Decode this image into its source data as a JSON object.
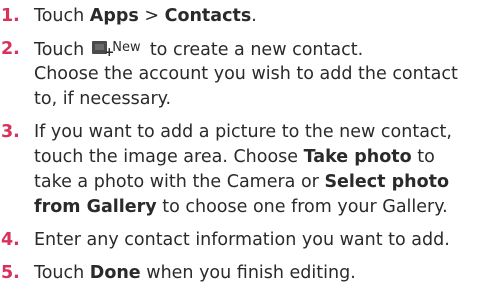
{
  "steps": [
    {
      "number": "1.",
      "lines": [
        {
          "a": "Touch ",
          "b1": "Apps",
          "c": " > ",
          "b2": "Contacts",
          "d": "."
        }
      ]
    },
    {
      "number": "2.",
      "icon_name": "new-contact-icon",
      "icon_label": "New",
      "lines": [
        {
          "a": "Touch",
          "after_icon": "to create a new contact."
        },
        {
          "a": "Choose the account you wish to add the contact"
        },
        {
          "a": "to, if necessary."
        }
      ]
    },
    {
      "number": "3.",
      "lines": [
        {
          "a": "If you want to add a picture to the new contact,"
        },
        {
          "a": "touch the image area. Choose ",
          "b1": "Take photo",
          "c": " to"
        },
        {
          "a": "take a photo with the Camera or ",
          "b1": "Select photo"
        },
        {
          "b1": "from Gallery",
          "c": " to choose one from your Gallery."
        }
      ]
    },
    {
      "number": "4.",
      "lines": [
        {
          "a": "Enter any contact information you want to add."
        }
      ]
    },
    {
      "number": "5.",
      "lines": [
        {
          "a": "Touch ",
          "b1": "Done",
          "c": " when you finish editing."
        }
      ]
    }
  ],
  "colors": {
    "step_number": "#d9305c",
    "text": "#2a2a2a"
  }
}
